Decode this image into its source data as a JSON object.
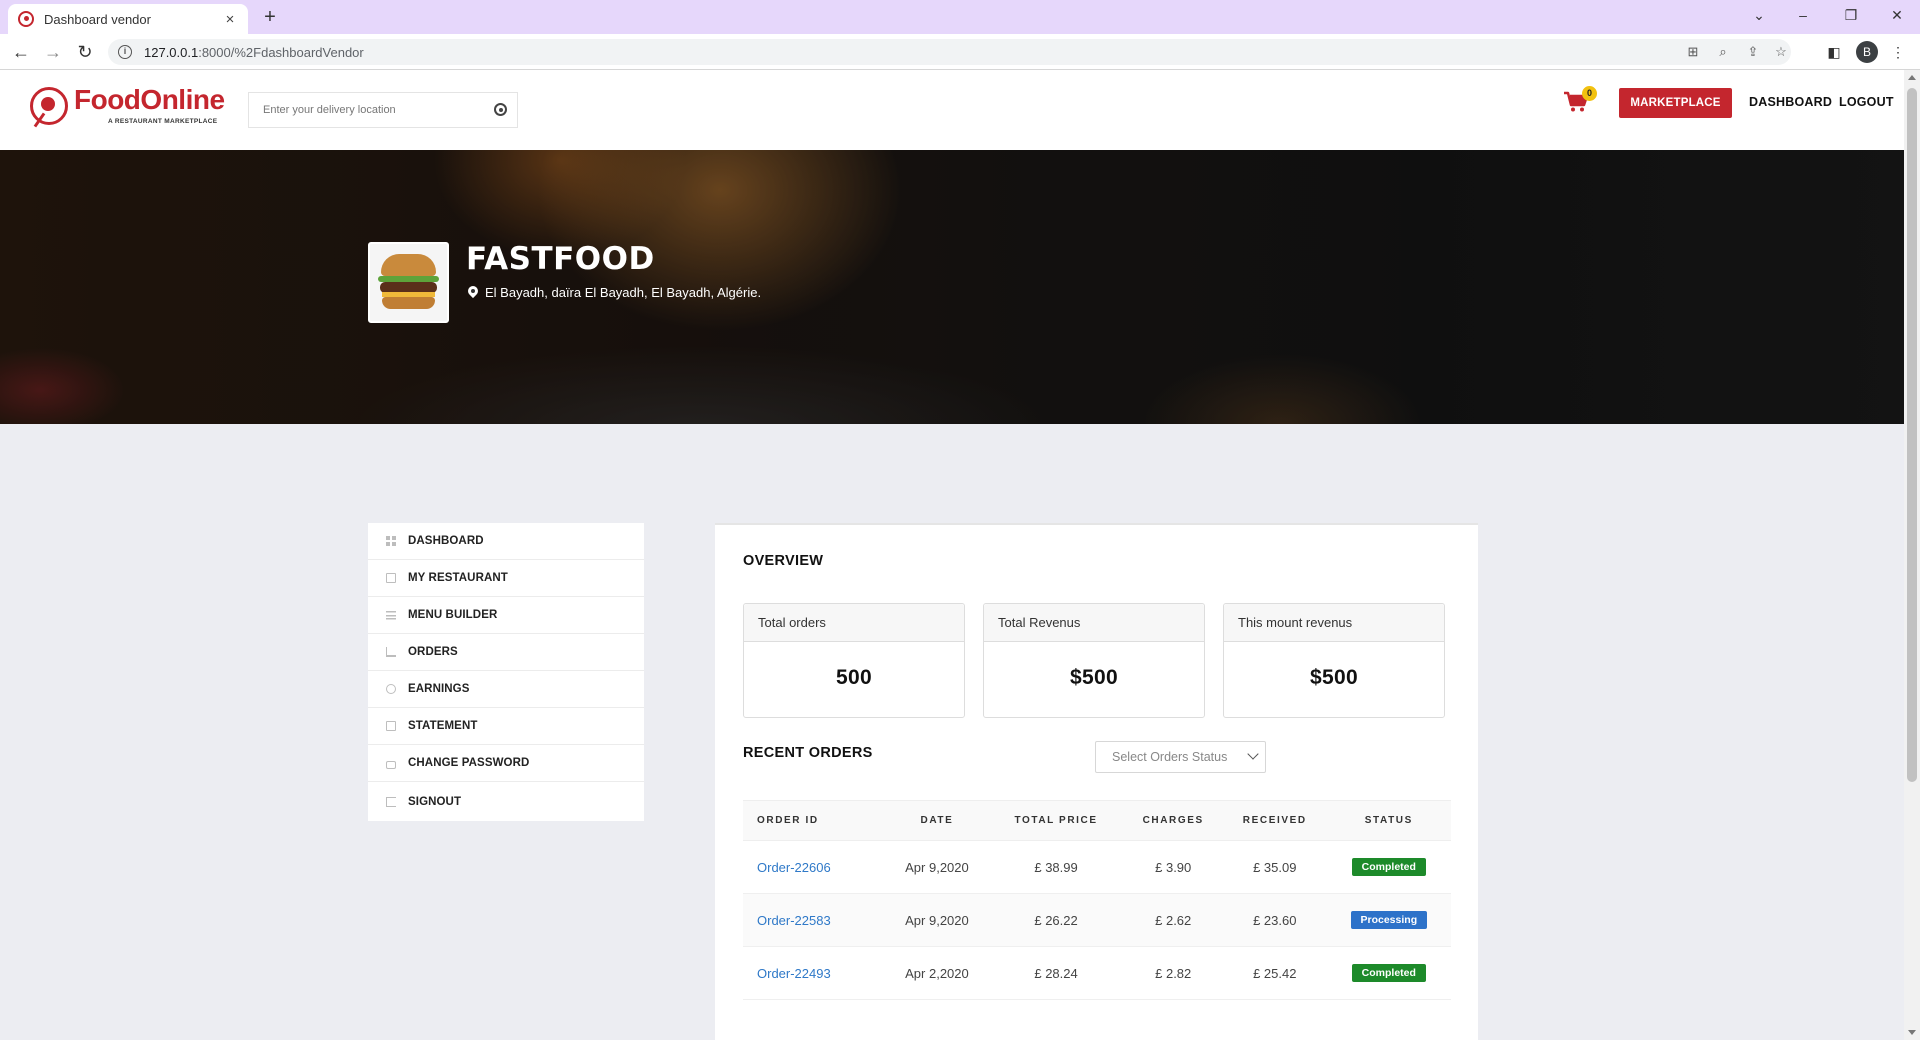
{
  "browser": {
    "tab_title": "Dashboard vendor",
    "new_tab": "+",
    "close_tab": "×",
    "url_host": "127.0.0.1",
    "url_rest": ":8000/%2FdashboardVendor",
    "profile_initial": "B"
  },
  "header": {
    "logo_text": "FoodOnline",
    "logo_tagline": "A RESTAURANT MARKETPLACE",
    "location_placeholder": "Enter your delivery location",
    "cart_count": "0",
    "marketplace_label": "MARKETPLACE",
    "dashboard_label": "DASHBOARD",
    "logout_label": "LOGOUT"
  },
  "restaurant": {
    "name": "FASTFOOD",
    "address": "El Bayadh, daïra El Bayadh, El Bayadh, Algérie."
  },
  "sidebar": {
    "items": [
      {
        "label": "DASHBOARD",
        "icon": "dashboard-icon"
      },
      {
        "label": "MY RESTAURANT",
        "icon": "restaurant-icon"
      },
      {
        "label": "MENU BUILDER",
        "icon": "menu-icon"
      },
      {
        "label": "ORDERS",
        "icon": "cart-icon"
      },
      {
        "label": "EARNINGS",
        "icon": "money-icon"
      },
      {
        "label": "STATEMENT",
        "icon": "document-icon"
      },
      {
        "label": "CHANGE PASSWORD",
        "icon": "lock-icon"
      },
      {
        "label": "SIGNOUT",
        "icon": "signout-icon"
      }
    ]
  },
  "overview": {
    "title": "OVERVIEW",
    "cards": [
      {
        "label": "Total orders",
        "value": "500"
      },
      {
        "label": "Total Revenus",
        "value": "$500"
      },
      {
        "label": "This mount revenus",
        "value": "$500"
      }
    ]
  },
  "recent_orders": {
    "title": "RECENT ORDERS",
    "filter_placeholder": "Select Orders Status",
    "columns": [
      "ORDER ID",
      "DATE",
      "TOTAL PRICE",
      "CHARGES",
      "RECEIVED",
      "STATUS"
    ],
    "rows": [
      {
        "id": "Order-22606",
        "date": "Apr 9,2020",
        "total": "£ 38.99",
        "charges": "£ 3.90",
        "received": "£ 35.09",
        "status": "Completed"
      },
      {
        "id": "Order-22583",
        "date": "Apr 9,2020",
        "total": "£ 26.22",
        "charges": "£ 2.62",
        "received": "£ 23.60",
        "status": "Processing"
      },
      {
        "id": "Order-22493",
        "date": "Apr 2,2020",
        "total": "£ 28.24",
        "charges": "£ 2.82",
        "received": "£ 25.42",
        "status": "Completed"
      }
    ]
  },
  "colors": {
    "brand_red": "#c4262e",
    "completed_green": "#1d8a2a",
    "processing_blue": "#2d72c9",
    "link_blue": "#2f79c8"
  }
}
